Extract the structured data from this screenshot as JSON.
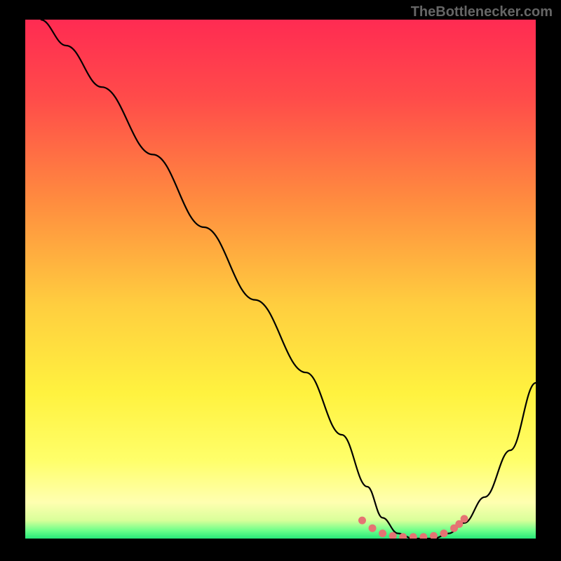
{
  "watermark": "TheBottlenecker.com",
  "chart_data": {
    "type": "line",
    "title": "",
    "xlabel": "",
    "ylabel": "",
    "xlim": [
      0,
      100
    ],
    "ylim": [
      0,
      100
    ],
    "gradient_stops": [
      {
        "offset": 0.0,
        "color": "#ff2b52"
      },
      {
        "offset": 0.15,
        "color": "#ff4b4a"
      },
      {
        "offset": 0.35,
        "color": "#ff8c3f"
      },
      {
        "offset": 0.55,
        "color": "#ffce3f"
      },
      {
        "offset": 0.72,
        "color": "#fff23f"
      },
      {
        "offset": 0.85,
        "color": "#ffff6a"
      },
      {
        "offset": 0.93,
        "color": "#ffffb0"
      },
      {
        "offset": 0.965,
        "color": "#d9ff9a"
      },
      {
        "offset": 0.985,
        "color": "#6aff8a"
      },
      {
        "offset": 1.0,
        "color": "#27e87a"
      }
    ],
    "series": [
      {
        "name": "bottleneck-curve",
        "color": "#000000",
        "x": [
          3,
          8,
          15,
          25,
          35,
          45,
          55,
          62,
          67,
          70,
          73,
          76,
          80,
          83,
          86,
          90,
          95,
          100
        ],
        "y": [
          100,
          95,
          87,
          74,
          60,
          46,
          32,
          20,
          10,
          4,
          1,
          0,
          0,
          1,
          3,
          8,
          17,
          30
        ]
      },
      {
        "name": "optimal-range-markers",
        "type": "scatter",
        "color": "#e57373",
        "x": [
          66,
          68,
          70,
          72,
          74,
          76,
          78,
          80,
          82,
          84,
          85,
          86
        ],
        "y": [
          3.5,
          2,
          1,
          0.5,
          0.3,
          0.3,
          0.3,
          0.5,
          1,
          2,
          2.8,
          3.8
        ]
      }
    ]
  }
}
